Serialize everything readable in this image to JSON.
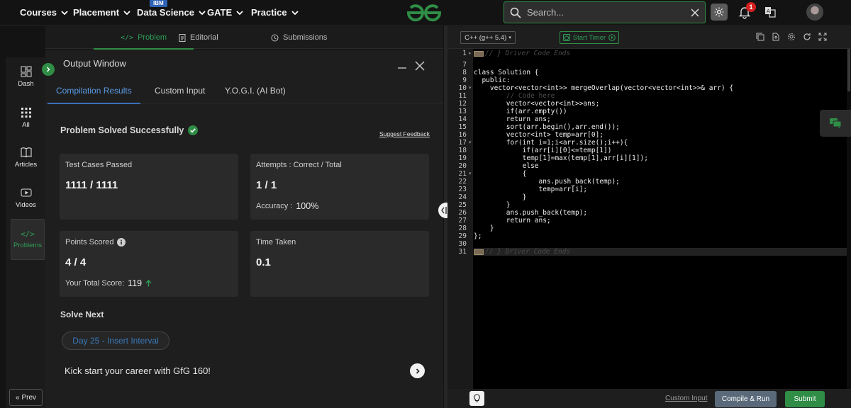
{
  "topnav": {
    "items": [
      {
        "label": "Courses"
      },
      {
        "label": "Placement"
      },
      {
        "label": "Data Science"
      },
      {
        "label": "GATE"
      },
      {
        "label": "Practice"
      }
    ],
    "ibm_badge": "IBM",
    "search_placeholder": "Search...",
    "notification_count": "1",
    "brand_color": "#2f8d46"
  },
  "problem_tabs": [
    {
      "label": "Problem",
      "icon": "code-icon"
    },
    {
      "label": "Editorial",
      "icon": "document-icon"
    },
    {
      "label": "Submissions",
      "icon": "clock-icon"
    }
  ],
  "sidebar": {
    "items": [
      {
        "label": "Dash",
        "icon": "dashboard-icon"
      },
      {
        "label": "All",
        "icon": "grid-icon"
      },
      {
        "label": "Articles",
        "icon": "book-icon"
      },
      {
        "label": "Videos",
        "icon": "video-icon"
      },
      {
        "label": "Problems",
        "icon": "code-icon"
      }
    ],
    "prev_label": "Prev"
  },
  "output": {
    "title": "Output Window",
    "tabs": [
      {
        "label": "Compilation Results"
      },
      {
        "label": "Custom Input"
      },
      {
        "label": "Y.O.G.I. (AI Bot)"
      }
    ],
    "status": "Problem Solved Successfully",
    "feedback_label": "Suggest Feedback",
    "cards": {
      "tests": {
        "label": "Test Cases Passed",
        "value": "1111 / 1111"
      },
      "attempts": {
        "label": "Attempts : Correct / Total",
        "value": "1 / 1",
        "sub_label": "Accuracy :",
        "sub_value": "100%"
      },
      "points": {
        "label": "Points Scored",
        "value": "4 / 4",
        "sub_label": "Your Total Score:",
        "sub_value": "119"
      },
      "time": {
        "label": "Time Taken",
        "value": "0.1"
      }
    },
    "solve_next_label": "Solve Next",
    "next_problem": "Day 25 - Insert Interval",
    "promo": "Kick start your career with GfG 160!"
  },
  "editor": {
    "language": "C++ (g++ 5.4)",
    "timer_label": "Start Timer",
    "line_numbers": [
      "1",
      "7",
      "8",
      "9",
      "10",
      "11",
      "12",
      "13",
      "14",
      "15",
      "16",
      "17",
      "18",
      "19",
      "20",
      "21",
      "22",
      "23",
      "24",
      "25",
      "26",
      "27",
      "28",
      "29",
      "30",
      "31"
    ],
    "code_lines": [
      "// } Driver Code Ends",
      "",
      "class Solution {",
      "  public:",
      "    vector<vector<int>> mergeOverlap(vector<vector<int>>& arr) {",
      "        // Code here",
      "        vector<vector<int>>ans;",
      "        if(arr.empty())",
      "        return ans;",
      "        sort(arr.begin(),arr.end());",
      "        vector<int> temp=arr[0];",
      "        for(int i=1;i<arr.size();i++){",
      "            if(arr[i][0]<=temp[1])",
      "            temp[1]=max(temp[1],arr[i][1]);",
      "            else",
      "            {",
      "                ans.push_back(temp);",
      "                temp=arr[i];",
      "            }",
      "        }",
      "        ans.push_back(temp);",
      "        return ans;",
      "    }",
      "};",
      "",
      "// } Driver Code Ends"
    ],
    "custom_input_label": "Custom Input",
    "compile_label": "Compile & Run",
    "submit_label": "Submit"
  }
}
